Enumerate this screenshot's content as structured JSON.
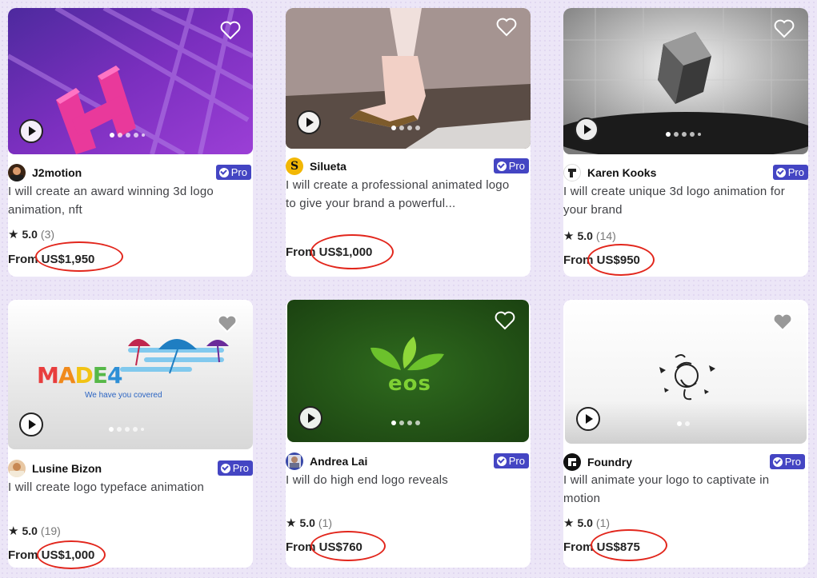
{
  "accent_colors": {
    "pro_badge": "#4445c3",
    "highlight_ellipse": "#e2261c"
  },
  "gigs": [
    {
      "seller": "J2motion",
      "pro": "Pro",
      "title_line1": "I will create an award winning 3d logo",
      "title_line2": "animation, nft",
      "rating": "5.0",
      "count": "(3)",
      "from": "From",
      "price": "US$1,950",
      "icon": "play-icon"
    },
    {
      "seller": "Silueta",
      "pro": "Pro",
      "title_line1": "I will create a professional animated logo",
      "title_line2": "to give your brand a powerful...",
      "rating": "",
      "count": "",
      "from": "From",
      "price": "US$1,000",
      "icon": "play-icon"
    },
    {
      "seller": "Karen Kooks",
      "pro": "Pro",
      "title_line1": "I will create unique 3d logo animation for",
      "title_line2": "your brand",
      "rating": "5.0",
      "count": "(14)",
      "from": "From",
      "price": "US$950",
      "icon": "play-icon"
    },
    {
      "seller": "Lusine Bizon",
      "pro": "Pro",
      "title_line1": "I will create logo typeface animation",
      "title_line2": "",
      "rating": "5.0",
      "count": "(19)",
      "from": "From",
      "price": "US$1,000",
      "thumb_logo": "MADE4",
      "thumb_tagline": "We have you covered",
      "icon": "play-icon"
    },
    {
      "seller": "Andrea Lai",
      "pro": "Pro",
      "title_line1": "I will do high end logo reveals",
      "title_line2": "",
      "rating": "5.0",
      "count": "(1)",
      "from": "From",
      "price": "US$760",
      "thumb_logo": "eos",
      "icon": "play-icon"
    },
    {
      "seller": "Foundry",
      "pro": "Pro",
      "title_line1": "I will animate your logo to captivate in",
      "title_line2": "motion",
      "rating": "5.0",
      "count": "(1)",
      "from": "From",
      "price": "US$875",
      "icon": "play-icon"
    }
  ]
}
